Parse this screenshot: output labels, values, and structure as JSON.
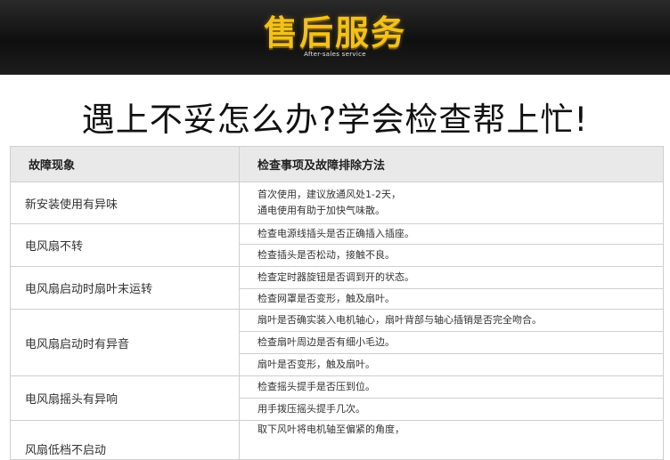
{
  "banner": {
    "title": "售后服务",
    "subtitle": "After-sales service"
  },
  "headline": "遇上不妥怎么办?学会检查帮上忙!",
  "table": {
    "headers": [
      "故障现象",
      "检查事项及故障排除方法"
    ],
    "groups": [
      {
        "symptom": "新安装使用有异味",
        "fixes": [
          "首次使用，建议放通风处1-2天，\n通电使用有助于加快气味散。"
        ]
      },
      {
        "symptom": "电风扇不转",
        "fixes": [
          "检查电源线插头是否正确插入插座。",
          "检查插头是否松动，接触不良。"
        ]
      },
      {
        "symptom": "电风扇启动时扇叶末运转",
        "fixes": [
          "检查定时器旋钮是否调到开的状态。",
          "检查网罩是否变形，触及扇叶。"
        ]
      },
      {
        "symptom": "电风扇启动时有异音",
        "fixes": [
          "扇叶是否确实装入电机轴心，扇叶背部与轴心插销是否完全吻合。",
          "检查扇叶周边是否有细小毛边。",
          "扇叶是否变形，触及扇叶。"
        ]
      },
      {
        "symptom": "电风扇摇头有异响",
        "fixes": [
          "检查摇头提手是否压到位。",
          "用手拨压摇头提手几次。"
        ]
      },
      {
        "symptom": "风扇低档不启动",
        "fixes": [
          "取下风叶将电机轴至偏紧的角度，"
        ]
      }
    ]
  }
}
